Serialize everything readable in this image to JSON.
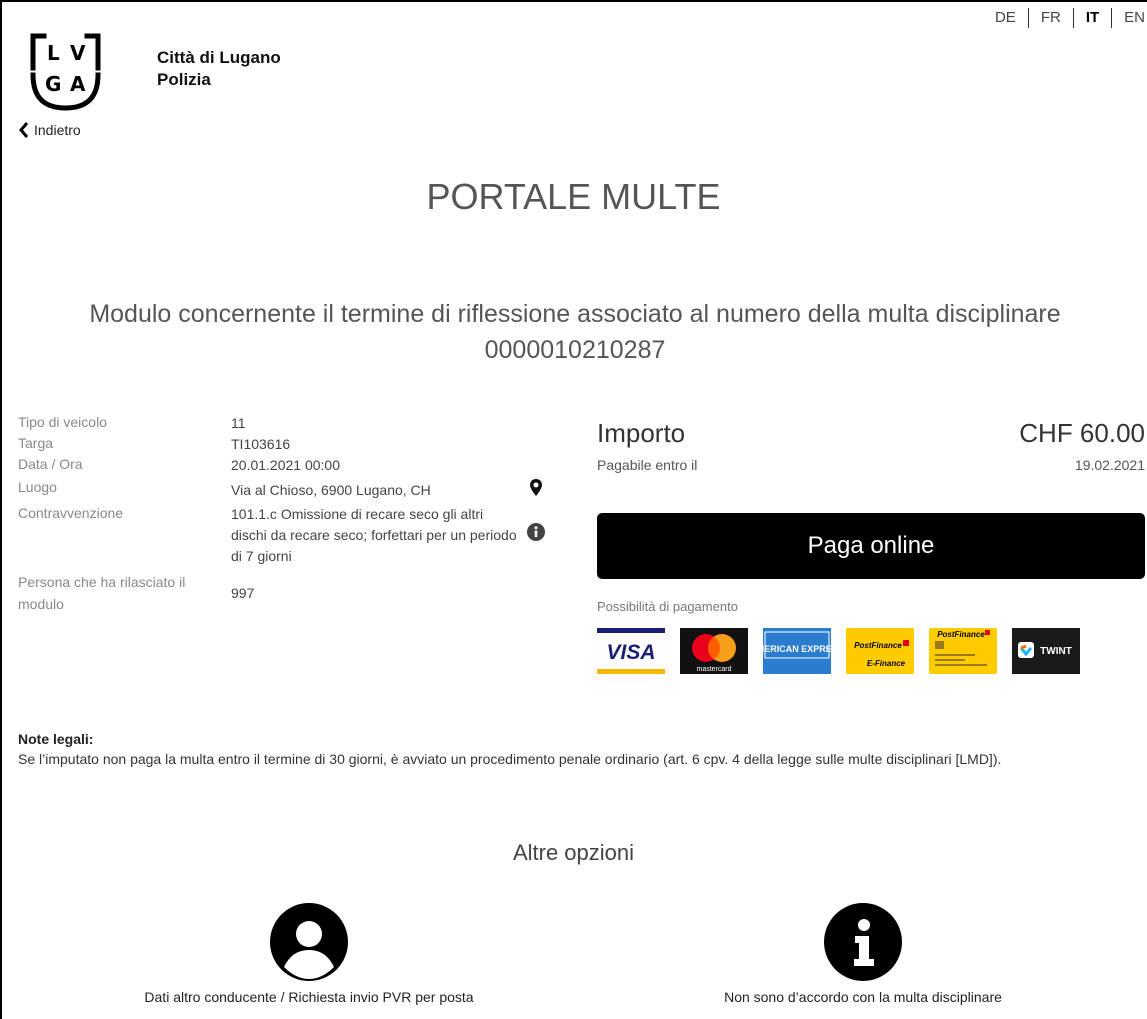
{
  "languages": [
    {
      "label": "DE",
      "active": false
    },
    {
      "label": "FR",
      "active": false
    },
    {
      "label": "IT",
      "active": true
    },
    {
      "label": "EN",
      "active": false
    }
  ],
  "brand": {
    "logo_letters": "LVGA",
    "line1": "Città di Lugano",
    "line2": "Polizia"
  },
  "nav": {
    "back_label": "Indietro"
  },
  "page": {
    "title": "PORTALE MULTE",
    "subtitle_line1": "Modulo concernente il termine di riflessione associato al numero della multa disciplinare",
    "subtitle_line2": "0000010210287"
  },
  "details": {
    "tipo_label": "Tipo di veicolo",
    "tipo_value": "11",
    "targa_label": "Targa",
    "targa_value": "TI103616",
    "data_label": "Data / Ora",
    "data_value": "20.01.2021 00:00",
    "luogo_label": "Luogo",
    "luogo_value": "Via al Chioso, 6900 Lugano, CH",
    "contr_label": "Contravvenzione",
    "contr_value": "101.1.c Omissione di recare seco gli altri dischi da recare seco; forfettari per un periodo di 7 giorni",
    "persona_label": "Persona che ha rilasciato il modulo",
    "persona_value": "997"
  },
  "payment": {
    "amount_label": "Importo",
    "amount_value": "CHF 60.00",
    "due_label": "Pagabile entro il",
    "due_value": "19.02.2021",
    "pay_button": "Paga online",
    "methods_label": "Possibilità di pagamento",
    "card_texts": {
      "visa": "VISA",
      "mastercard": "mastercard",
      "amex": "AMERICAN EXPRESS",
      "pf_efinance_top": "PostFinance",
      "pf_efinance_bottom": "E-Finance",
      "pf_card": "PostFinance",
      "twint": "TWINT"
    }
  },
  "legal": {
    "heading": "Note legali:",
    "text": "Se l’imputato non paga la multa entro il termine di 30 giorni, è avviato un procedimento penale ordinario (art. 6 cpv. 4 della legge sulle multe disciplinari [LMD])."
  },
  "options": {
    "heading": "Altre opzioni",
    "driver_label": "Dati altro conducente / Richiesta invio PVR per posta",
    "disagree_label": "Non sono d’accordo con la multa disciplinare"
  }
}
